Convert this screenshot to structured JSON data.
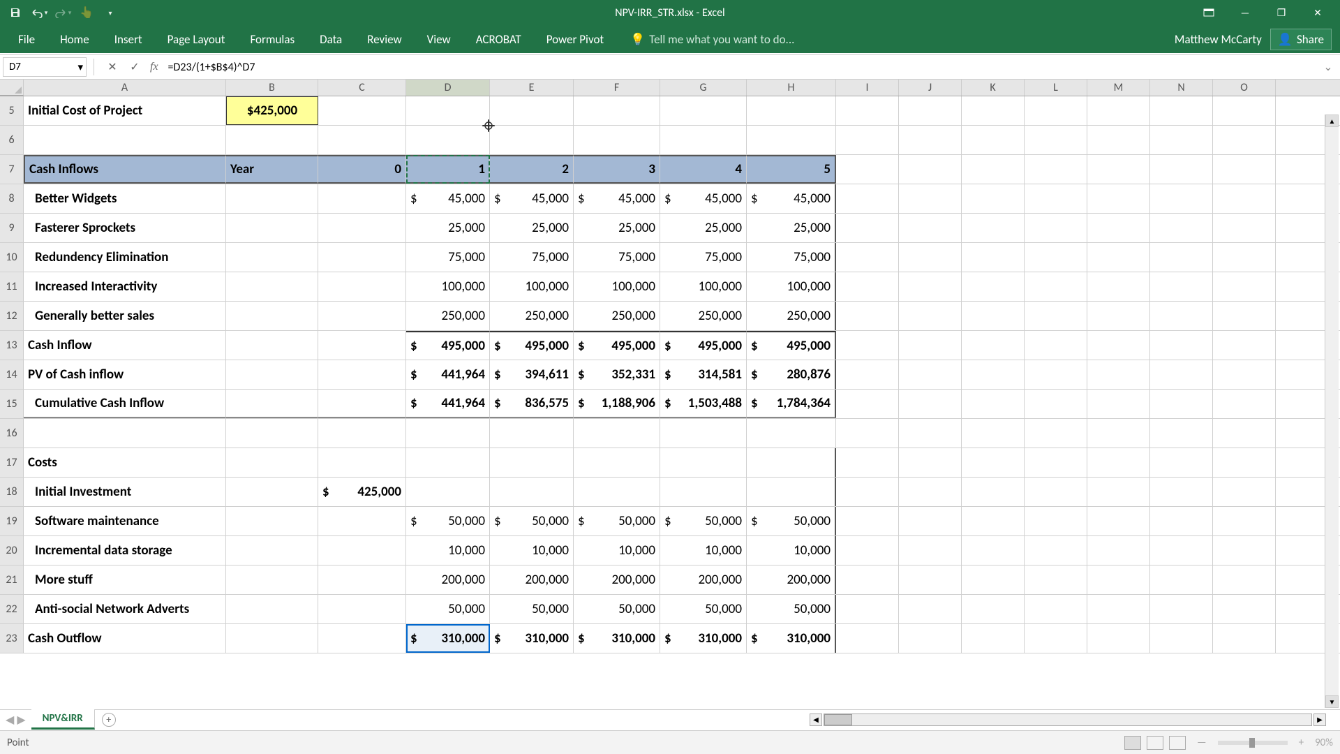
{
  "title": "NPV-IRR_STR.xlsx - Excel",
  "ribbon": {
    "tabs": [
      "File",
      "Home",
      "Insert",
      "Page Layout",
      "Formulas",
      "Data",
      "Review",
      "View",
      "ACROBAT",
      "Power Pivot"
    ],
    "tellme": "Tell me what you want to do...",
    "user": "Matthew McCarty",
    "share": "Share"
  },
  "namebox": "D7",
  "formula": "=D23/(1+$B$4)^D7",
  "columns": [
    "A",
    "B",
    "C",
    "D",
    "E",
    "F",
    "G",
    "H",
    "I",
    "J",
    "K",
    "L",
    "M",
    "N",
    "O"
  ],
  "rest_cols": [
    "I",
    "J",
    "K",
    "L",
    "M",
    "N",
    "O"
  ],
  "rows": {
    "5": {
      "a": "Initial Cost of Project",
      "b": "$425,000"
    },
    "7": {
      "a": "Cash Inflows",
      "b": "Year",
      "c": "0",
      "d": "1",
      "e": "2",
      "f": "3",
      "g": "4",
      "h": "5"
    },
    "8": {
      "a": "Better Widgets",
      "d": "45,000",
      "e": "45,000",
      "f": "45,000",
      "g": "45,000",
      "h": "45,000",
      "cur": true
    },
    "9": {
      "a": "Fasterer Sprockets",
      "d": "25,000",
      "e": "25,000",
      "f": "25,000",
      "g": "25,000",
      "h": "25,000"
    },
    "10": {
      "a": "Redundency Elimination",
      "d": "75,000",
      "e": "75,000",
      "f": "75,000",
      "g": "75,000",
      "h": "75,000"
    },
    "11": {
      "a": "Increased Interactivity",
      "d": "100,000",
      "e": "100,000",
      "f": "100,000",
      "g": "100,000",
      "h": "100,000"
    },
    "12": {
      "a": "Generally better sales",
      "d": "250,000",
      "e": "250,000",
      "f": "250,000",
      "g": "250,000",
      "h": "250,000"
    },
    "13": {
      "a": "Cash Inflow",
      "d": "495,000",
      "e": "495,000",
      "f": "495,000",
      "g": "495,000",
      "h": "495,000",
      "cur": true,
      "bold": true
    },
    "14": {
      "a": "PV of Cash inflow",
      "d": "441,964",
      "e": "394,611",
      "f": "352,331",
      "g": "314,581",
      "h": "280,876",
      "cur": true,
      "bold": true
    },
    "15": {
      "a": "Cumulative Cash Inflow",
      "d": "441,964",
      "e": "836,575",
      "f": "1,188,906",
      "g": "1,503,488",
      "h": "1,784,364",
      "cur": true,
      "bold": true
    },
    "17": {
      "a": "Costs",
      "bold": true
    },
    "18": {
      "a": "Initial Investment",
      "c": "425,000",
      "cur_c": true
    },
    "19": {
      "a": "Software maintenance",
      "d": "50,000",
      "e": "50,000",
      "f": "50,000",
      "g": "50,000",
      "h": "50,000",
      "cur": true
    },
    "20": {
      "a": "Incremental data storage",
      "d": "10,000",
      "e": "10,000",
      "f": "10,000",
      "g": "10,000",
      "h": "10,000"
    },
    "21": {
      "a": "More stuff",
      "d": "200,000",
      "e": "200,000",
      "f": "200,000",
      "g": "200,000",
      "h": "200,000"
    },
    "22": {
      "a": "Anti-social Network Adverts",
      "d": "50,000",
      "e": "50,000",
      "f": "50,000",
      "g": "50,000",
      "h": "50,000"
    },
    "23": {
      "a": "Cash Outflow",
      "d": "310,000",
      "e": "310,000",
      "f": "310,000",
      "g": "310,000",
      "h": "310,000",
      "cur": true,
      "bold": true
    }
  },
  "sheet_tab": "NPV&IRR",
  "status": "Point",
  "zoom": "90%"
}
